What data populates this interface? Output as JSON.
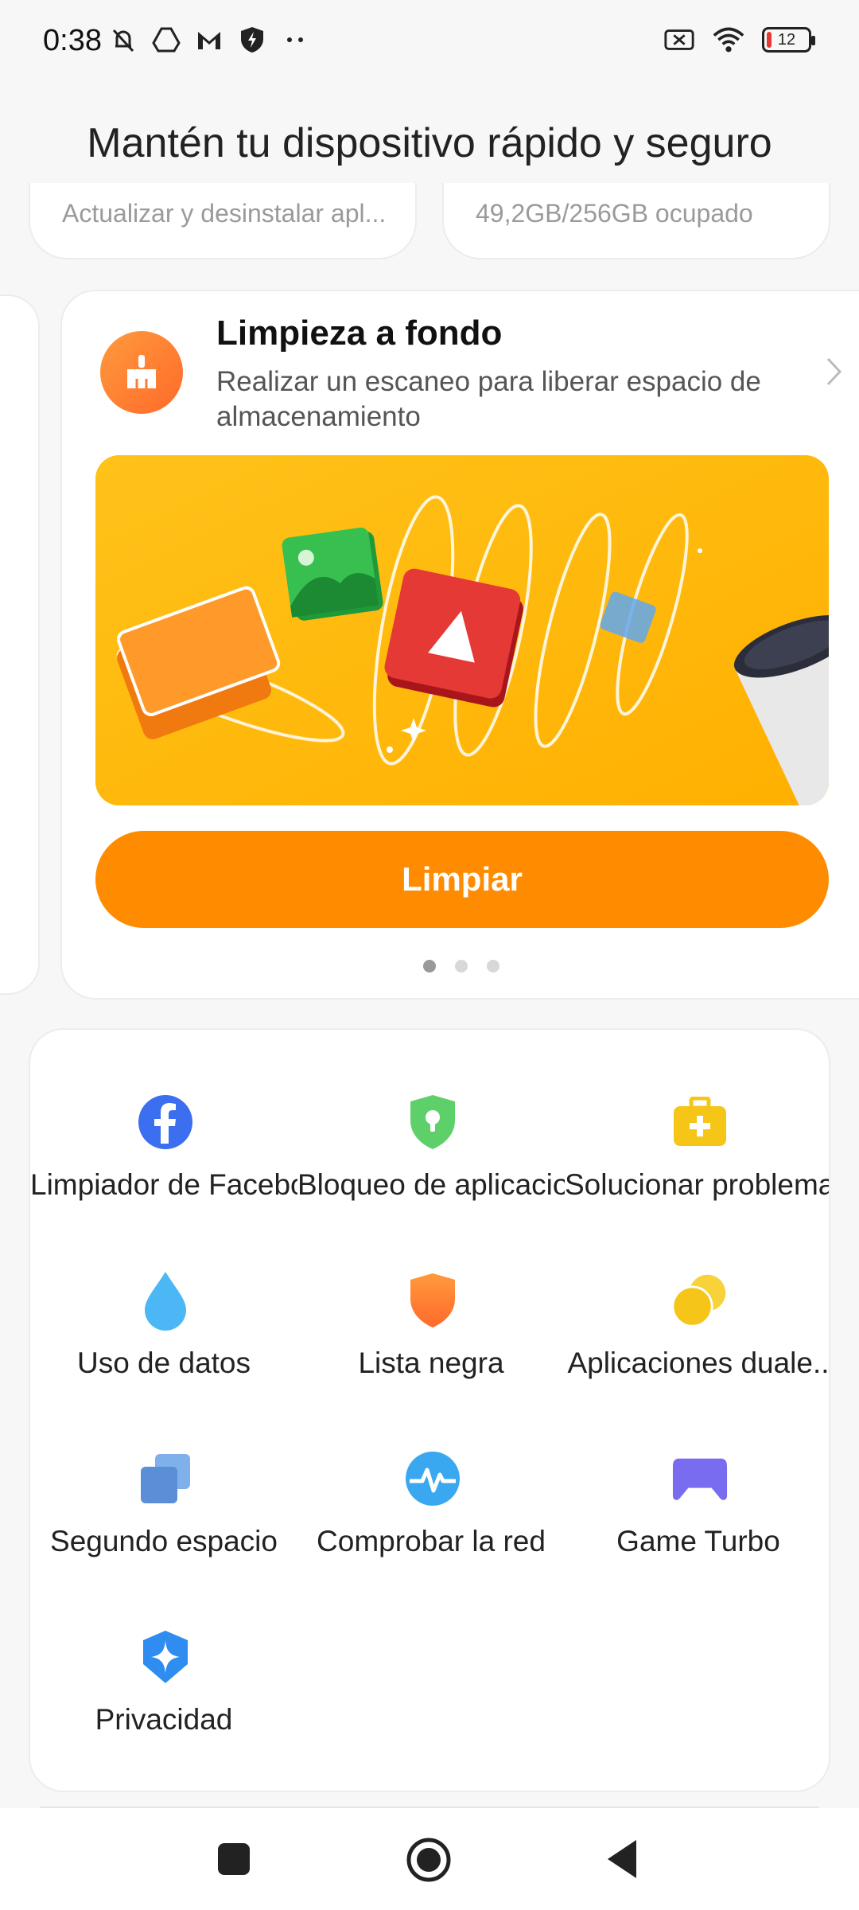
{
  "status_bar": {
    "time": "0:38",
    "battery": "12",
    "icons_left": [
      "muted-bell-icon",
      "drive-icon",
      "gmail-icon",
      "shield-bolt-icon",
      "more-dots-icon"
    ],
    "icons_right": [
      "no-sim-icon",
      "wifi-icon",
      "battery-icon"
    ]
  },
  "header": {
    "title": "Mantén tu dispositivo rápido y seguro"
  },
  "top_cards": [
    {
      "subtitle": "Actualizar y desinstalar apl..."
    },
    {
      "subtitle": "49,2GB/256GB ocupado"
    }
  ],
  "feature_card": {
    "title": "Limpieza a fondo",
    "subtitle": "Realizar un escaneo para liberar espacio de almacenamiento",
    "button_label": "Limpiar",
    "accent": "#ff8c00",
    "banner_color": "#ffbb10",
    "page_count": 3,
    "active_page": 1
  },
  "tools": [
    {
      "label": "Limpiador de Facebook",
      "icon": "facebook-icon",
      "color": "#3b6ff0"
    },
    {
      "label": "Bloqueo de aplicaciones",
      "icon": "shield-lock-icon",
      "color": "#5ed06a"
    },
    {
      "label": "Solucionar problemas",
      "icon": "first-aid-kit-icon",
      "color": "#f5c518"
    },
    {
      "label": "Uso de datos",
      "icon": "water-drop-icon",
      "color": "#4bb8f5"
    },
    {
      "label": "Lista negra",
      "icon": "shield-icon",
      "color": "#ff8a3d"
    },
    {
      "label": "Aplicaciones duale..",
      "icon": "dual-apps-icon",
      "color": "#f5c518"
    },
    {
      "label": "Segundo espacio",
      "icon": "second-space-icon",
      "color": "#6a9be0"
    },
    {
      "label": "Comprobar la red",
      "icon": "network-pulse-icon",
      "color": "#3aa8f0"
    },
    {
      "label": "Game Turbo",
      "icon": "gamepad-icon",
      "color": "#7a6cf0"
    },
    {
      "label": "Privacidad",
      "icon": "privacy-icon",
      "color": "#2f8cf0"
    }
  ],
  "nav": {
    "buttons": [
      "recents-button",
      "home-button",
      "back-button"
    ]
  }
}
